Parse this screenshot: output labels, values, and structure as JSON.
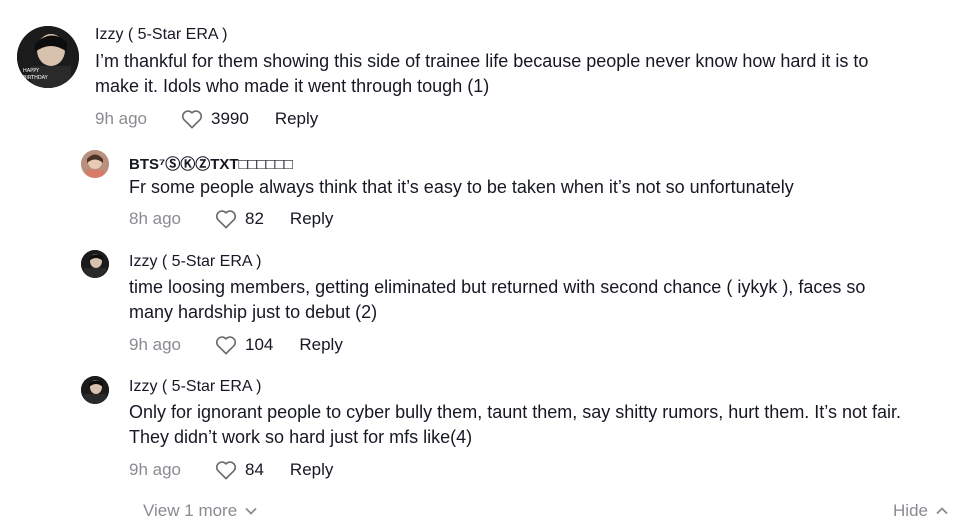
{
  "comments": [
    {
      "username": "Izzy ( 5-Star ERA )",
      "text": "I’m thankful for them showing this side of trainee life because people never know how hard it is to make it. Idols who made it went through tough (1)",
      "time": "9h ago",
      "likes": "3990",
      "reply": "Reply"
    },
    {
      "username": "BTS⁷ⓈⓀⓏTXT",
      "username_boxes": "□□□□□□",
      "text": "Fr some people always think that it’s easy to be taken when it’s not so unfortunately",
      "time": "8h ago",
      "likes": "82",
      "reply": "Reply"
    },
    {
      "username": "Izzy ( 5-Star ERA )",
      "text": "time loosing members, getting eliminated but returned with second chance ( iykyk ), faces so many hardship just to debut (2)",
      "time": "9h ago",
      "likes": "104",
      "reply": "Reply"
    },
    {
      "username": "Izzy ( 5-Star ERA )",
      "text": "Only for ignorant people to cyber bully them, taunt them, say shitty rumors, hurt them. It’s not fair. They didn’t work so hard just for mfs like(4)",
      "time": "9h ago",
      "likes": "84",
      "reply": "Reply"
    }
  ],
  "footer": {
    "view_more": "View 1 more",
    "hide": "Hide"
  },
  "icons": {
    "like": "heart-outline-icon",
    "expand": "chevron-down-icon",
    "collapse": "chevron-up-icon"
  },
  "colors": {
    "text": "#161823",
    "muted": "#8a8b91"
  }
}
